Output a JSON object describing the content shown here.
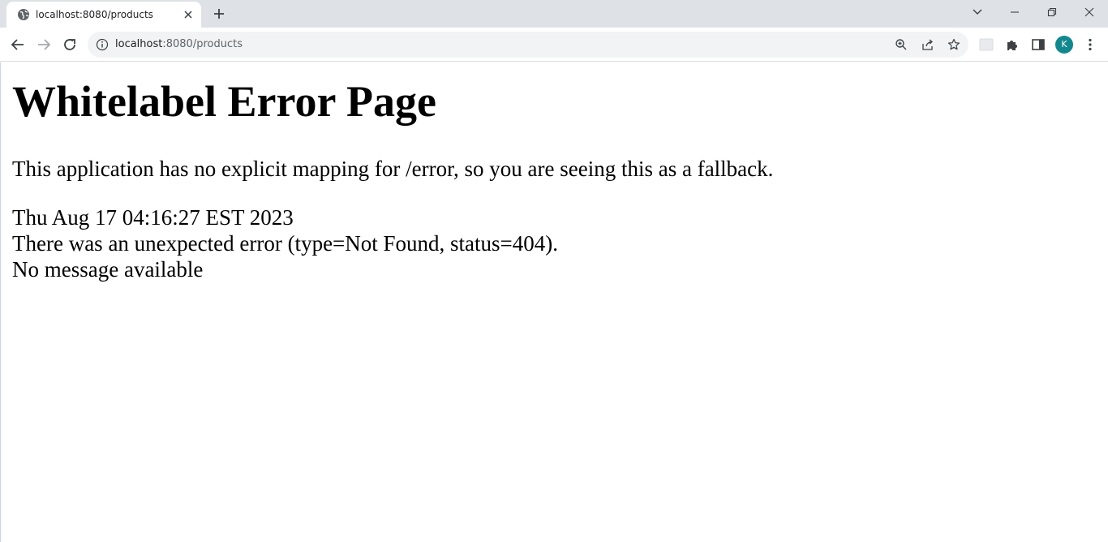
{
  "browser": {
    "tab": {
      "title": "localhost:8080/products",
      "favicon": "globe-icon"
    },
    "address_bar": {
      "host": "localhost",
      "rest": ":8080/products"
    },
    "profile_initial": "K",
    "colors": {
      "tabstrip": "#dee1e6",
      "avatar": "#12878e"
    }
  },
  "page": {
    "heading": "Whitelabel Error Page",
    "description": "This application has no explicit mapping for /error, so you are seeing this as a fallback.",
    "timestamp": "Thu Aug 17 04:16:27 EST 2023",
    "error_line": "There was an unexpected error (type=Not Found, status=404).",
    "message": "No message available"
  }
}
